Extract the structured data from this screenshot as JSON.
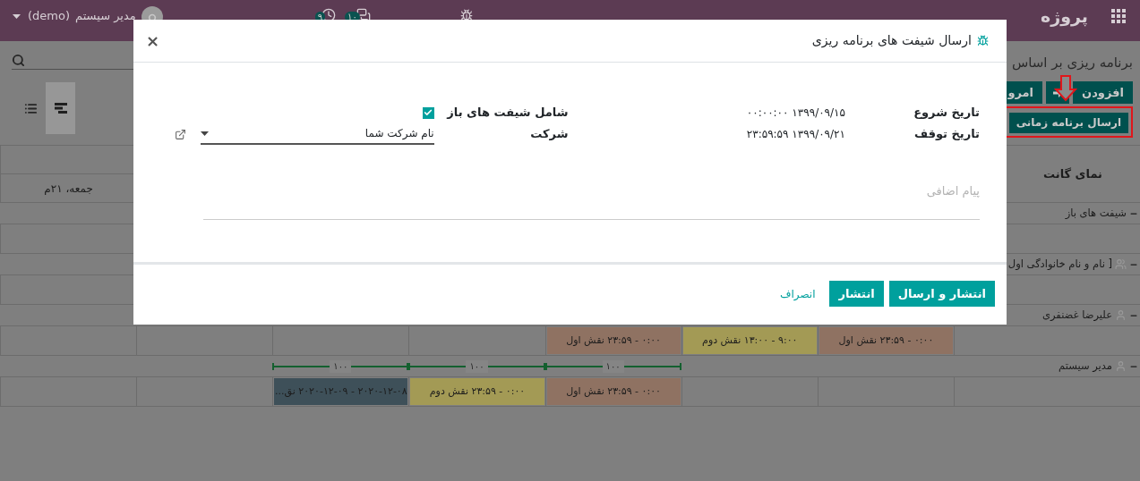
{
  "navbar": {
    "app_title": "پروژه",
    "notifications": [
      {
        "kind": "chat",
        "count": "۱۰"
      },
      {
        "kind": "activity",
        "count": "۹"
      }
    ],
    "user": {
      "name": "مدیر سیستم",
      "database": "(demo)"
    }
  },
  "control_panel": {
    "title": "برنامه ریزی بر اساس",
    "buttons": [
      {
        "kind": "text",
        "label": "افزودن"
      },
      {
        "kind": "next"
      },
      {
        "kind": "text",
        "label": "امرو"
      }
    ],
    "send_button": {
      "label": "ارسال برنامه زمانی",
      "highlighted": true
    },
    "views": [
      {
        "kind": "list",
        "selected": false
      },
      {
        "kind": "gantt",
        "selected": true
      }
    ]
  },
  "gantt": {
    "title": "نمای گانت",
    "days": [
      {
        "kind": "empty"
      },
      {
        "kind": "empty"
      },
      {
        "kind": "empty"
      },
      {
        "kind": "empty"
      },
      {
        "kind": "empty"
      },
      {
        "kind": "empty"
      },
      {
        "kind": "empty"
      },
      {
        "kind": "day",
        "label": "جمعه، ۲۱م"
      }
    ],
    "resources": [
      {
        "kind": "open",
        "name": "شیفت های باز",
        "expanded": true
      },
      {
        "kind": "group",
        "name": "[ نام و نام خانوادگی اول",
        "expanded": true
      },
      {
        "kind": "person",
        "name": "علیرضا غضنفری",
        "expanded": true,
        "cells": [
          {
            "kind": "empty"
          },
          {
            "kind": "shift",
            "text": "۰:۰۰ - ۲۳:۵۹ نقش اول",
            "color": "#8f7262"
          },
          {
            "kind": "shift",
            "text": "۹:۰۰ - ۱۳:۰۰ نقش دوم",
            "color": "#a39a55"
          },
          {
            "kind": "shift",
            "text": "۰:۰۰ - ۲۳:۵۹ نقش اول",
            "color": "#8f7262"
          },
          {
            "kind": "empty"
          },
          {
            "kind": "empty"
          },
          {
            "kind": "empty"
          },
          {
            "kind": "empty"
          }
        ]
      },
      {
        "kind": "person",
        "name": "مدیر سیستم",
        "expanded": true,
        "allocations": [
          {
            "kind": "empty"
          },
          {
            "kind": "empty"
          },
          {
            "kind": "empty"
          },
          {
            "kind": "allocation",
            "value": "۱۰۰"
          },
          {
            "kind": "allocation",
            "value": "۱۰۰"
          },
          {
            "kind": "allocation",
            "value": "۱۰۰"
          },
          {
            "kind": "empty"
          },
          {
            "kind": "empty"
          }
        ],
        "cells": [
          {
            "kind": "empty"
          },
          {
            "kind": "empty"
          },
          {
            "kind": "empty"
          },
          {
            "kind": "shift",
            "text": "۰:۰۰ - ۲۳:۵۹ نقش اول",
            "color": "#8f7262"
          },
          {
            "kind": "shift",
            "text": "۰:۰۰ - ۲۳:۵۹ نقش دوم",
            "color": "#a39a55"
          },
          {
            "kind": "shift",
            "text": "۲۰۲۰-۱۲-۰۸ - ۲۰۲۰-۱۲-۰۹ نق...",
            "color": "#3e5059"
          },
          {
            "kind": "empty"
          },
          {
            "kind": "empty"
          }
        ]
      }
    ]
  },
  "dialog": {
    "title": "ارسال شیفت های برنامه ریزی",
    "close": "×",
    "fields": [
      {
        "label": "تاریخ شروع",
        "value": "۱۳۹۹/۰۹/۱۵ ۰۰:۰۰:۰۰"
      },
      {
        "label": "تاریخ توقف",
        "value": "۱۳۹۹/۰۹/۲۱ ۲۳:۵۹:۵۹"
      }
    ],
    "include_open_shifts": {
      "label": "شامل شیفت های باز",
      "checked": true
    },
    "company": {
      "label": "شرکت",
      "value": "نام شرکت شما"
    },
    "message": {
      "placeholder": "پیام اضافی"
    },
    "buttons": [
      {
        "kind": "primary",
        "label": "انتشار و ارسال"
      },
      {
        "kind": "primary",
        "label": "انتشار"
      },
      {
        "kind": "link",
        "label": "انصراف"
      }
    ]
  }
}
